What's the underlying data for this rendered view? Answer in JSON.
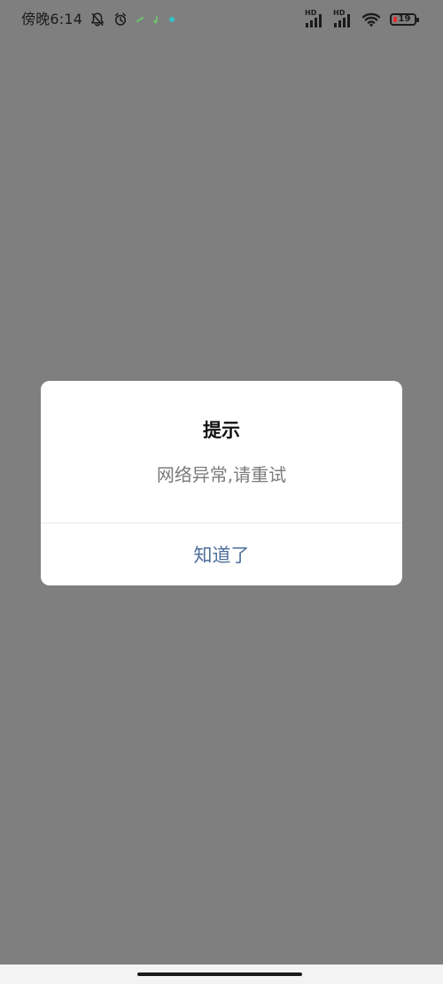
{
  "status_bar": {
    "time": "傍晚6:14",
    "icons": {
      "mute": "bell-slash-icon",
      "alarm": "alarm-clock-icon",
      "notif1": "green-notification-icon",
      "notif2": "music-note-icon",
      "notif3": "teal-dot-icon"
    },
    "signal1_label": "HD",
    "signal2_label": "HD",
    "battery_level": "19",
    "colors": {
      "battery_low": "#e3302f",
      "notif_green": "#6ec86e",
      "notif_teal": "#36c1c7"
    }
  },
  "dialog": {
    "title": "提示",
    "message": "网络异常,请重试",
    "button_label": "知道了",
    "button_color": "#4d6e9a"
  }
}
